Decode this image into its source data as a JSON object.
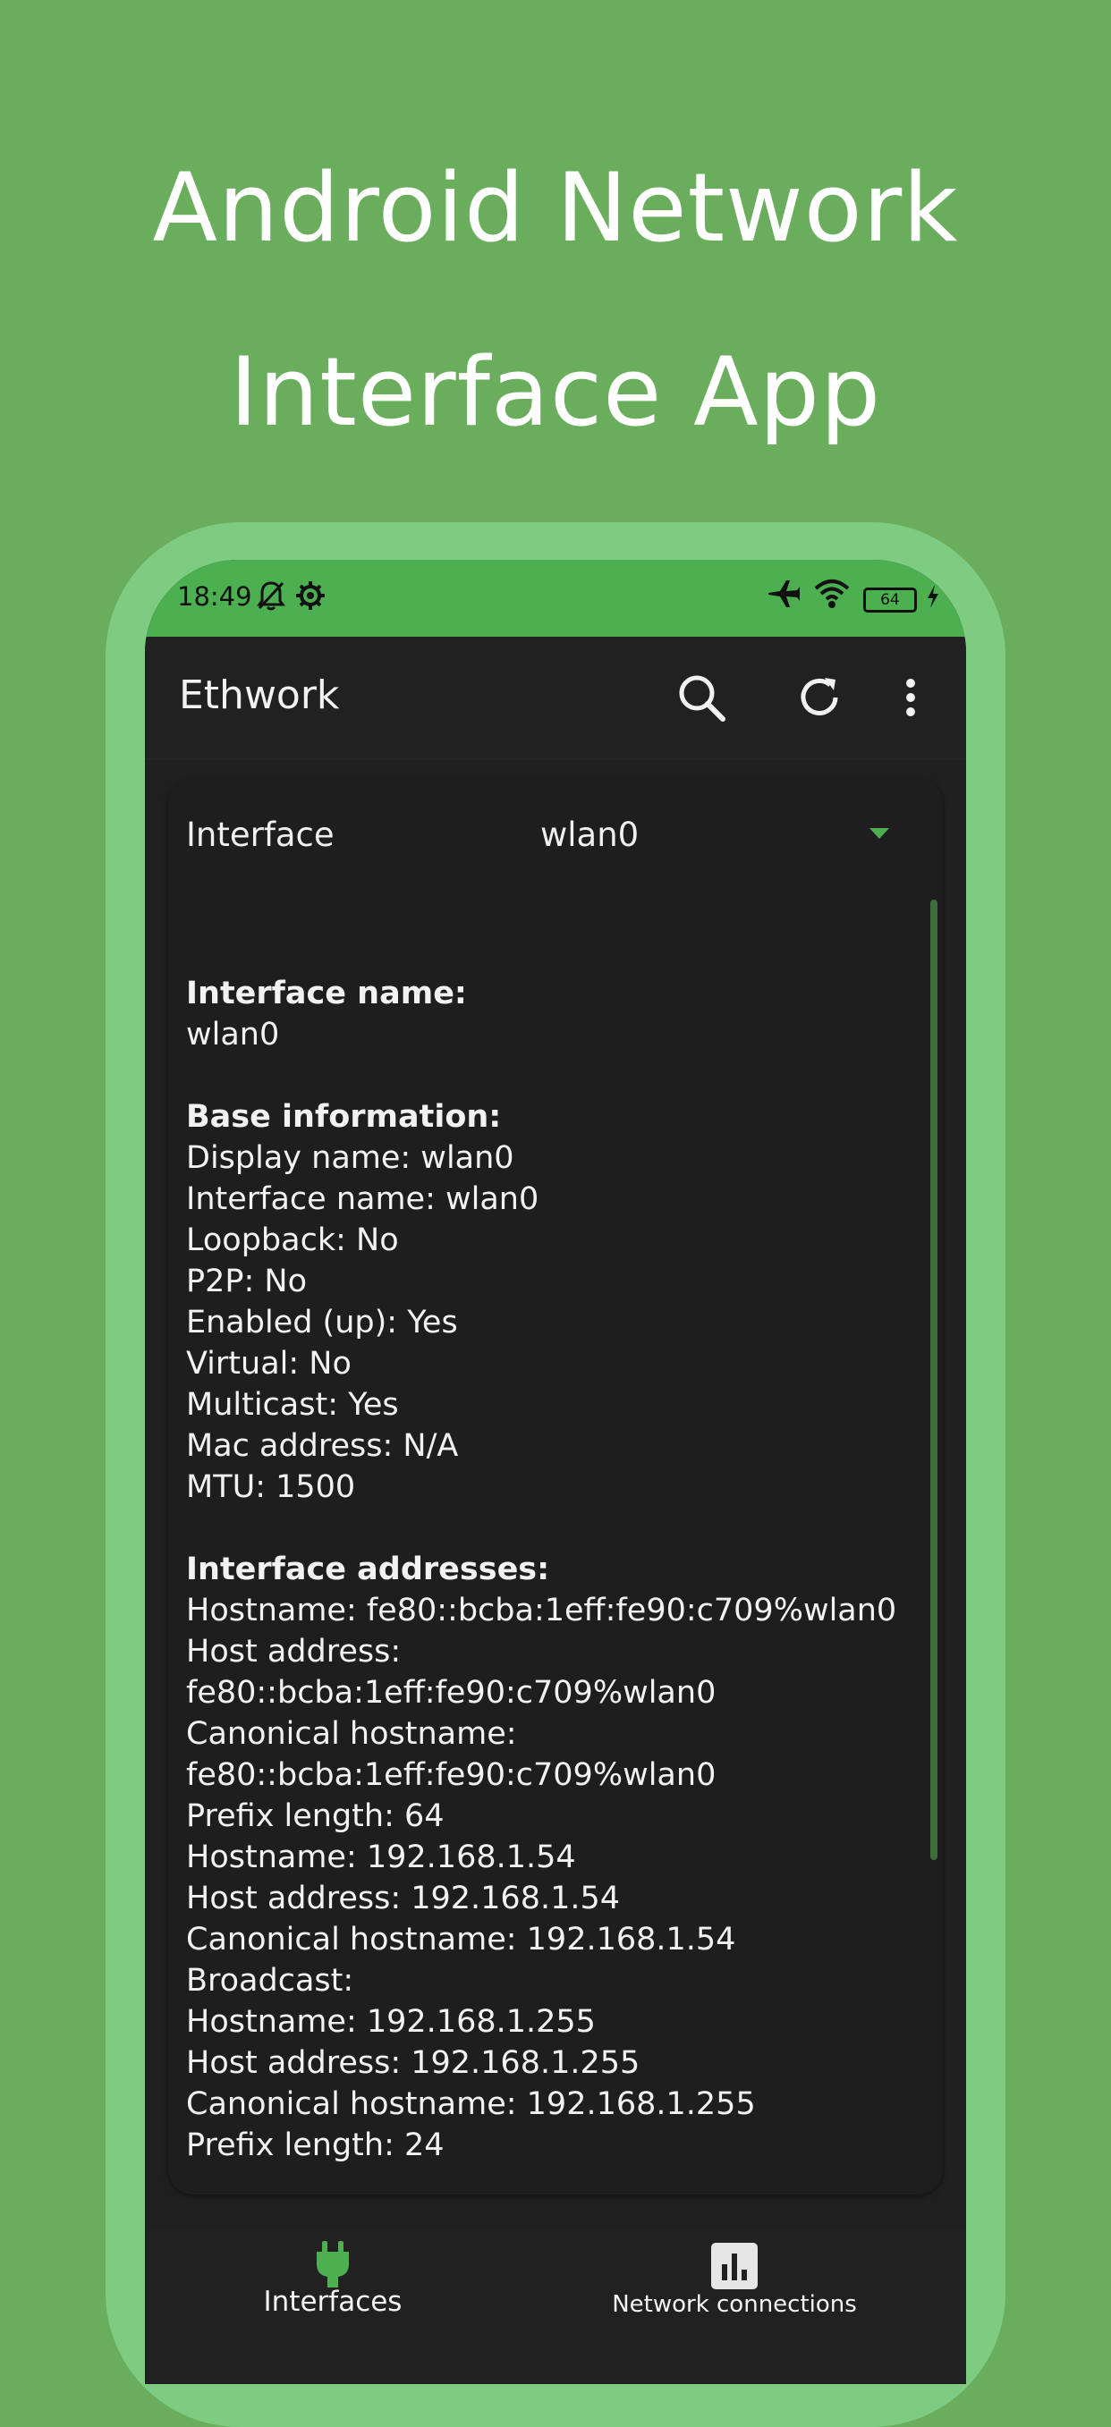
{
  "promo": {
    "title_line1": "Android Network",
    "title_line2": "Interface App"
  },
  "status_bar": {
    "time": "18:49",
    "battery": "64",
    "left_icons": [
      "bell-off-icon",
      "gear-icon"
    ],
    "right_icons": [
      "airplane-icon",
      "wifi-icon",
      "battery-icon",
      "charging-bolt-icon"
    ]
  },
  "app_bar": {
    "title": "Ethwork",
    "actions": [
      "search-icon",
      "refresh-icon",
      "more-vert-icon"
    ]
  },
  "interface_selector": {
    "label": "Interface",
    "value": "wlan0"
  },
  "details": {
    "interface_name_heading": "Interface name:",
    "interface_name_value": "wlan0",
    "base_heading": "Base information:",
    "base_lines": [
      "Display name: wlan0",
      "Interface name: wlan0",
      "Loopback: No",
      "P2P: No",
      "Enabled (up): Yes",
      "Virtual: No",
      "Multicast: Yes",
      "Mac address: N/A",
      "MTU: 1500"
    ],
    "addresses_heading": "Interface addresses:",
    "address_lines": [
      "Hostname: fe80::bcba:1eff:fe90:c709%wlan0",
      "Host address:",
      "fe80::bcba:1eff:fe90:c709%wlan0",
      "Canonical hostname:",
      "fe80::bcba:1eff:fe90:c709%wlan0",
      "Prefix length: 64",
      "Hostname: 192.168.1.54",
      "Host address: 192.168.1.54",
      "Canonical hostname: 192.168.1.54",
      "Broadcast:",
      "Hostname: 192.168.1.255",
      "Host address: 192.168.1.255",
      "Canonical hostname: 192.168.1.255",
      "Prefix length: 24"
    ]
  },
  "fab": {
    "icon": "share-icon"
  },
  "bottom_nav": {
    "items": [
      {
        "label": "Interfaces",
        "icon": "plug-icon",
        "selected": true
      },
      {
        "label": "Network connections",
        "icon": "bar-chart-icon",
        "selected": false
      }
    ]
  },
  "colors": {
    "background": "#69ad5d",
    "frame": "#7dcc82",
    "accent": "#4caf50",
    "surface": "#212121"
  }
}
